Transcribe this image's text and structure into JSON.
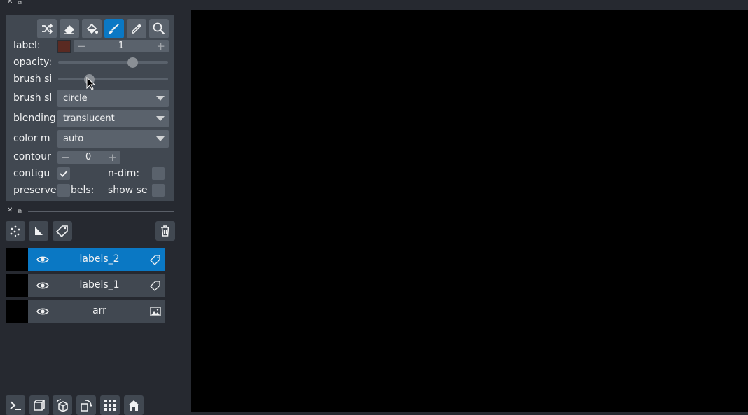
{
  "layer_controls": {
    "label_label": "label:",
    "label_value": "1",
    "label_color": "#5a2a22",
    "opacity_label": "opacity:",
    "opacity_value": 0.7,
    "brush_size_label": "brush si",
    "brush_size_value": 0.26,
    "brush_shape_label": "brush sl",
    "brush_shape_value": "circle",
    "blending_label": "blending",
    "blending_value": "translucent",
    "color_mode_label": "color m",
    "color_mode_value": "auto",
    "contour_label": "contour",
    "contour_value": "0",
    "contiguous_label": "contigu",
    "contiguous_checked": true,
    "ndim_label": "n-dim:",
    "ndim_checked": false,
    "preserve_label": "preserve",
    "preserve_suffix": "bels:",
    "preserve_checked": false,
    "show_selected_label": "show se",
    "show_selected_checked": false,
    "tools": [
      "shuffle-icon",
      "eraser-icon",
      "fill-bucket-icon",
      "paintbrush-icon",
      "color-picker-icon",
      "zoom-icon"
    ],
    "active_tool": "paintbrush-icon"
  },
  "layers": [
    {
      "name": "labels_2",
      "type": "labels",
      "selected": true,
      "visible": true
    },
    {
      "name": "labels_1",
      "type": "labels",
      "selected": false,
      "visible": true
    },
    {
      "name": "arr",
      "type": "image",
      "selected": false,
      "visible": true
    }
  ],
  "colors": {
    "accent": "#0a78c4",
    "panel": "#414851",
    "background": "#262930",
    "canvas": "#000000"
  }
}
